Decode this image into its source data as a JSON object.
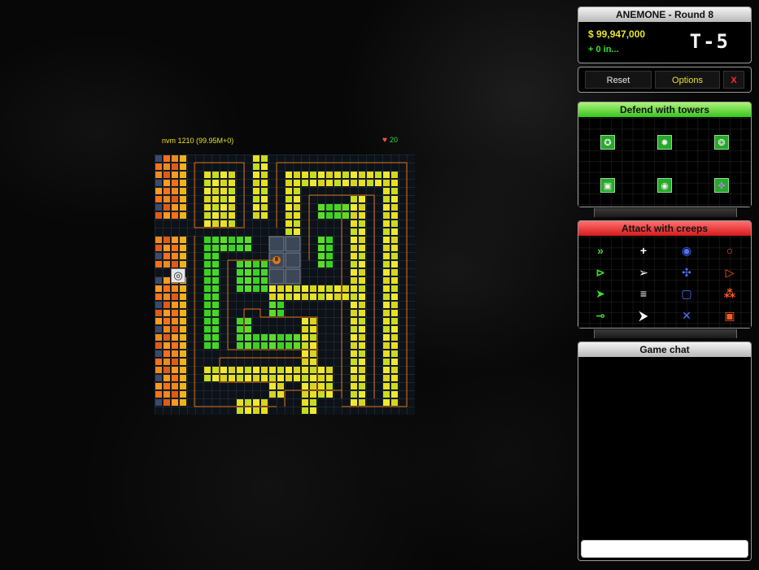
{
  "panel": {
    "title": "ANEMONE - Round 8",
    "money": "$ 99,947,000",
    "income": "+ 0 in...",
    "timer": "T-5",
    "buttons": {
      "reset": "Reset",
      "options": "Options",
      "close": "X"
    },
    "towers_title": "Defend with towers",
    "creeps_title": "Attack with creeps",
    "chat_title": "Game chat",
    "chat_placeholder": ""
  },
  "hud": {
    "score": "nvm 1210 (99.95M+0)",
    "lives": "20"
  },
  "core_label": "8",
  "colors": {
    "accent_green": "#36c51e",
    "accent_red": "#d51b1b",
    "money_yellow": "#e6e62a",
    "income_green": "#2ee82e",
    "options_yellow": "#e8e02a",
    "close_red": "#ff3030",
    "path_orange": "#d9700f"
  },
  "towers": [
    {
      "name": "gatling-tower-icon"
    },
    {
      "name": "burst-tower-icon"
    },
    {
      "name": "frost-tower-icon"
    },
    {
      "name": "block-tower-icon"
    },
    {
      "name": "splash-tower-icon"
    },
    {
      "name": "sniper-tower-icon"
    }
  ],
  "creeps": [
    {
      "name": "fast-creep-icon",
      "glyph": "»",
      "color": "#3ddc2f"
    },
    {
      "name": "cross-creep-icon",
      "glyph": "+",
      "color": "#ffffff"
    },
    {
      "name": "orb-creep-icon",
      "glyph": "◉",
      "color": "#4f72ff"
    },
    {
      "name": "ring-creep-icon",
      "glyph": "○",
      "color": "#ff5a24"
    },
    {
      "name": "arrow-creep-icon",
      "glyph": "⊳",
      "color": "#3ddc2f"
    },
    {
      "name": "jet-creep-icon",
      "glyph": "➢",
      "color": "#ffffff"
    },
    {
      "name": "spiral-creep-icon",
      "glyph": "✣",
      "color": "#4f72ff"
    },
    {
      "name": "triangle-creep-icon",
      "glyph": "▷",
      "color": "#ff5a24"
    },
    {
      "name": "dart-creep-icon",
      "glyph": "➤",
      "color": "#3ddc2f"
    },
    {
      "name": "stream-creep-icon",
      "glyph": "≡",
      "color": "#ffffff"
    },
    {
      "name": "square-creep-icon",
      "glyph": "▢",
      "color": "#4f72ff"
    },
    {
      "name": "cluster-creep-icon",
      "glyph": "⁂",
      "color": "#ff5a24"
    },
    {
      "name": "eye-creep-icon",
      "glyph": "⊸",
      "color": "#3ddc2f"
    },
    {
      "name": "glider-creep-icon",
      "glyph": "⮞",
      "color": "#ffffff"
    },
    {
      "name": "x-creep-icon",
      "glyph": "✕",
      "color": "#4f72ff"
    },
    {
      "name": "box-creep-icon",
      "glyph": "▣",
      "color": "#ff5a24"
    }
  ]
}
